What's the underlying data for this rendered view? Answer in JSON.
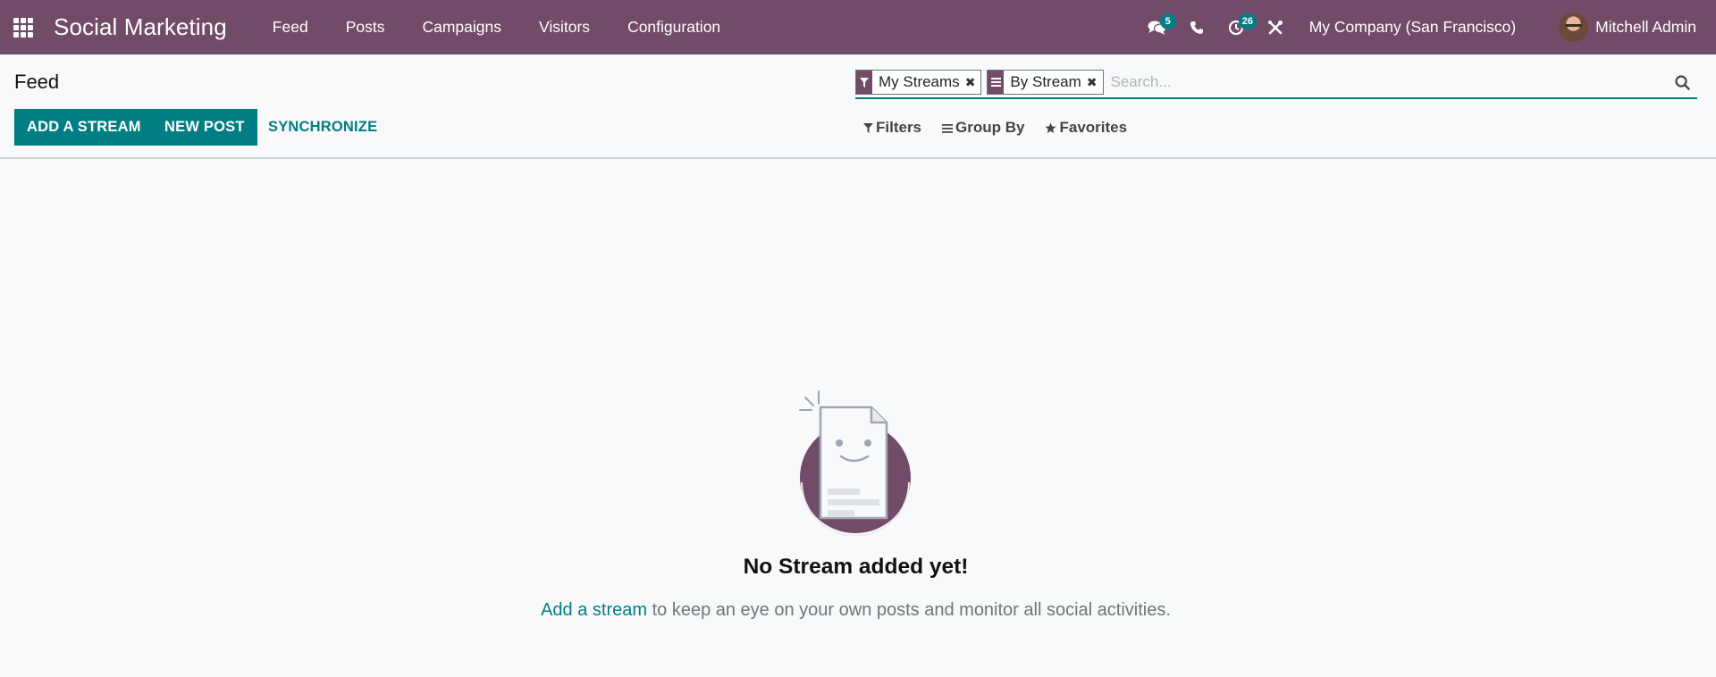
{
  "app": {
    "name": "Social Marketing",
    "menu": [
      "Feed",
      "Posts",
      "Campaigns",
      "Visitors",
      "Configuration"
    ]
  },
  "systray": {
    "messages_count": "5",
    "activities_count": "26",
    "company": "My Company (San Francisco)",
    "user": "Mitchell Admin",
    "icons": [
      "chat-icon",
      "phone-icon",
      "clock-icon",
      "tools-icon"
    ]
  },
  "control_panel": {
    "title": "Feed",
    "buttons": {
      "add_stream": "ADD A STREAM",
      "new_post": "NEW POST",
      "synchronize": "SYNCHRONIZE"
    },
    "search": {
      "facets": [
        {
          "icon": "filter-icon",
          "label": "My Streams"
        },
        {
          "icon": "group-by-icon",
          "label": "By Stream"
        }
      ],
      "placeholder": "Search..."
    },
    "options": {
      "filters": "Filters",
      "group_by": "Group By",
      "favorites": "Favorites"
    }
  },
  "empty_state": {
    "title": "No Stream added yet!",
    "link": "Add a stream",
    "text": " to keep an eye on your own posts and monitor all social activities."
  },
  "colors": {
    "brand": "#714b67",
    "accent": "#017e84",
    "background": "#f8f9fa"
  }
}
